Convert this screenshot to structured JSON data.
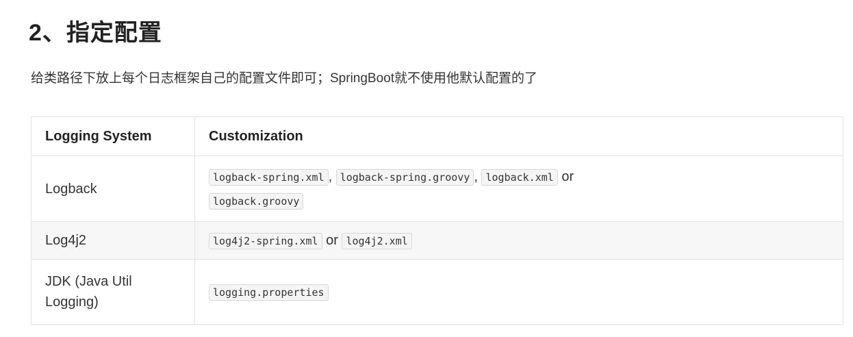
{
  "heading": "2、指定配置",
  "intro": "给类路径下放上每个日志框架自己的配置文件即可；SpringBoot就不使用他默认配置的了",
  "table": {
    "headers": [
      "Logging System",
      "Customization"
    ],
    "rows": [
      {
        "system": "Logback",
        "files": [
          "logback-spring.xml",
          "logback-spring.groovy",
          "logback.xml",
          "logback.groovy"
        ],
        "sep1": ",",
        "sep2": ",",
        "sep3": "or"
      },
      {
        "system": "Log4j2",
        "files": [
          "log4j2-spring.xml",
          "log4j2.xml"
        ],
        "sep1": "or"
      },
      {
        "system": "JDK (Java Util Logging)",
        "files": [
          "logging.properties"
        ]
      }
    ]
  }
}
